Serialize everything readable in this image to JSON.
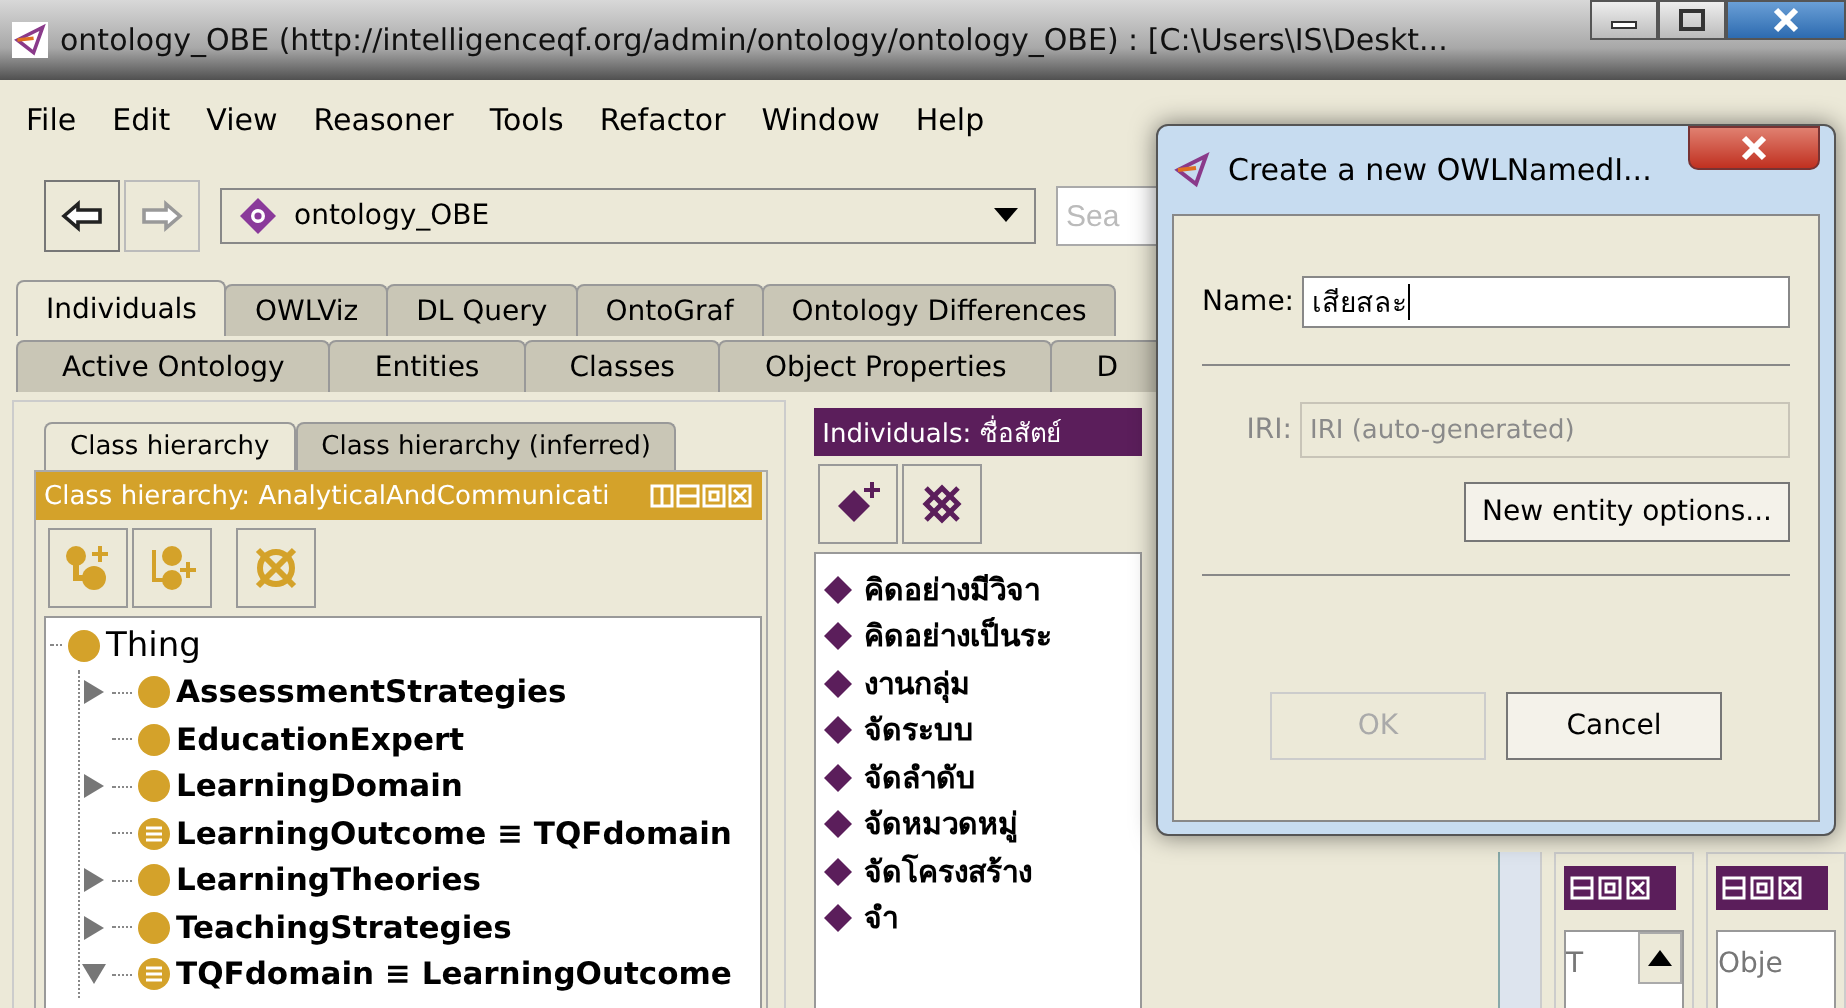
{
  "window": {
    "title": "ontology_OBE (http://intelligenceqf.org/admin/ontology/ontology_OBE)  : [C:\\Users\\IS\\Deskt..."
  },
  "menu": [
    "File",
    "Edit",
    "View",
    "Reasoner",
    "Tools",
    "Refactor",
    "Window",
    "Help"
  ],
  "toolbar": {
    "ontology": "ontology_OBE",
    "search": {
      "placeholder": "Sea"
    }
  },
  "tabs_row_1": [
    {
      "label": "Individuals",
      "selected": true
    },
    {
      "label": "OWLViz",
      "selected": false
    },
    {
      "label": "DL Query",
      "selected": false
    },
    {
      "label": "OntoGraf",
      "selected": false
    },
    {
      "label": "Ontology Differences",
      "selected": false
    }
  ],
  "tabs_row_2": [
    {
      "label": "Active Ontology",
      "selected": false
    },
    {
      "label": "Entities",
      "selected": false
    },
    {
      "label": "Classes",
      "selected": false
    },
    {
      "label": "Object Properties",
      "selected": false
    },
    {
      "label": "D",
      "selected": false
    }
  ],
  "class_panel": {
    "tabs": [
      {
        "label": "Class hierarchy",
        "selected": true
      },
      {
        "label": "Class hierarchy (inferred)",
        "selected": false
      }
    ],
    "header": "Class hierarchy: AnalyticalAndCommunicati",
    "tree": {
      "label": "Thing",
      "kind": "class",
      "children": [
        {
          "label": "AssessmentStrategies",
          "kind": "class",
          "expanded": false
        },
        {
          "label": "EducationExpert",
          "kind": "class"
        },
        {
          "label": "LearningDomain",
          "kind": "class",
          "expanded": false
        },
        {
          "label": "LearningOutcome ≡ TQFdomain",
          "kind": "defined"
        },
        {
          "label": "LearningTheories",
          "kind": "class",
          "expanded": false
        },
        {
          "label": "TeachingStrategies",
          "kind": "class",
          "expanded": false
        },
        {
          "label": "TQFdomain ≡ LearningOutcome",
          "kind": "defined",
          "expanded": true
        }
      ]
    }
  },
  "individuals_panel": {
    "header": "Individuals: ซื่อสัตย์",
    "items": [
      "คิดอย่างมีวิจา",
      "คิดอย่างเป็นระ",
      "งานกลุ่ม",
      "จัดระบบ",
      "จัดลำดับ",
      "จัดหมวดหมู่",
      "จัดโครงสร้าง",
      "จำ"
    ]
  },
  "bottom_panels": [
    {
      "text": "T"
    },
    {
      "text": "Obje"
    }
  ],
  "dialog": {
    "title": "Create a new OWLNamedI...",
    "name": {
      "label": "Name:",
      "value": "เสียสละ"
    },
    "iri": {
      "label": "IRI:",
      "placeholder": "IRI (auto-generated)",
      "disabled": true
    },
    "options_button": "New entity options...",
    "buttons": [
      {
        "label": "OK",
        "disabled": true
      },
      {
        "label": "Cancel",
        "disabled": false
      }
    ]
  }
}
